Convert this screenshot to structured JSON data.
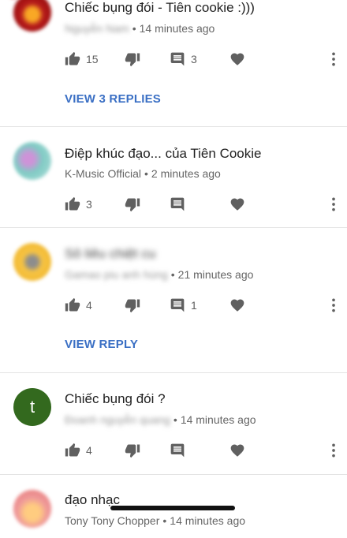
{
  "comments": [
    {
      "text": "Chiếc bụng đói - Tiên cookie :)))",
      "author": "Nguyễn Nam",
      "time": "14 minutes ago",
      "likes": "15",
      "replies_count": "3",
      "view_replies": "VIEW 3 REPLIES",
      "avatar_colors": [
        "#b71c1c",
        "#f9a825"
      ]
    },
    {
      "text": "Điệp khúc đạo... của Tiên Cookie",
      "author": "K-Music Official",
      "time": "2 minutes ago",
      "likes": "3",
      "avatar_colors": [
        "#80cbc4",
        "#ce93d8"
      ]
    },
    {
      "text": "Sô liêu chiệt cu",
      "author": "Gamao piu anh hùng",
      "time": "21 minutes ago",
      "likes": "4",
      "replies_count": "1",
      "view_replies": "VIEW REPLY",
      "avatar_colors": [
        "#f6c343",
        "#8d8d8d"
      ]
    },
    {
      "text": "Chiếc bụng đói ?",
      "author": "Đoanh nguyễn quang",
      "time": "14 minutes ago",
      "likes": "4",
      "avatar_letter": "t"
    },
    {
      "text": "đạo nhạc",
      "author": "Tony Tony Chopper",
      "time": "14 minutes ago",
      "avatar_colors": [
        "#ef9a9a",
        "#ffcc80"
      ]
    }
  ],
  "icons": {
    "like": "thumb-up-icon",
    "dislike": "thumb-down-icon",
    "reply": "comment-icon",
    "heart": "heart-icon",
    "more": "more-vert-icon"
  },
  "colors": {
    "link": "#3a6fc4",
    "icon": "#606060",
    "letter_avatar": "#33691e"
  }
}
